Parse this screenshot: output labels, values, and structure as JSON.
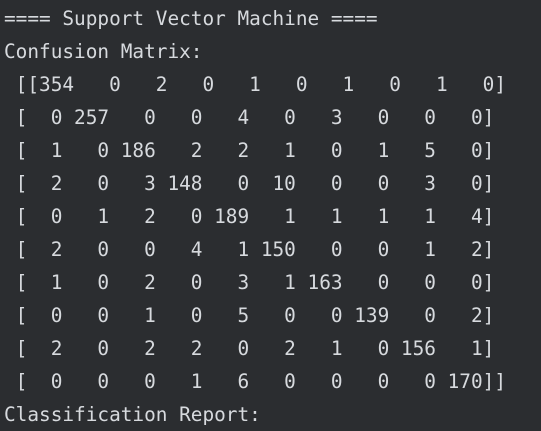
{
  "console": {
    "lines": [
      "==== Support Vector Machine ====",
      "Confusion Matrix:",
      " [[354   0   2   0   1   0   1   0   1   0]",
      " [  0 257   0   0   4   0   3   0   0   0]",
      " [  1   0 186   2   2   1   0   1   5   0]",
      " [  2   0   3 148   0  10   0   0   3   0]",
      " [  0   1   2   0 189   1   1   1   1   4]",
      " [  2   0   0   4   1 150   0   0   1   2]",
      " [  1   0   2   0   3   1 163   0   0   0]",
      " [  0   0   1   0   5   0   0 139   0   2]",
      " [  2   0   2   2   0   2   1   0 156   1]",
      " [  0   0   0   1   6   0   0   0   0 170]]",
      "Classification Report:"
    ]
  }
}
